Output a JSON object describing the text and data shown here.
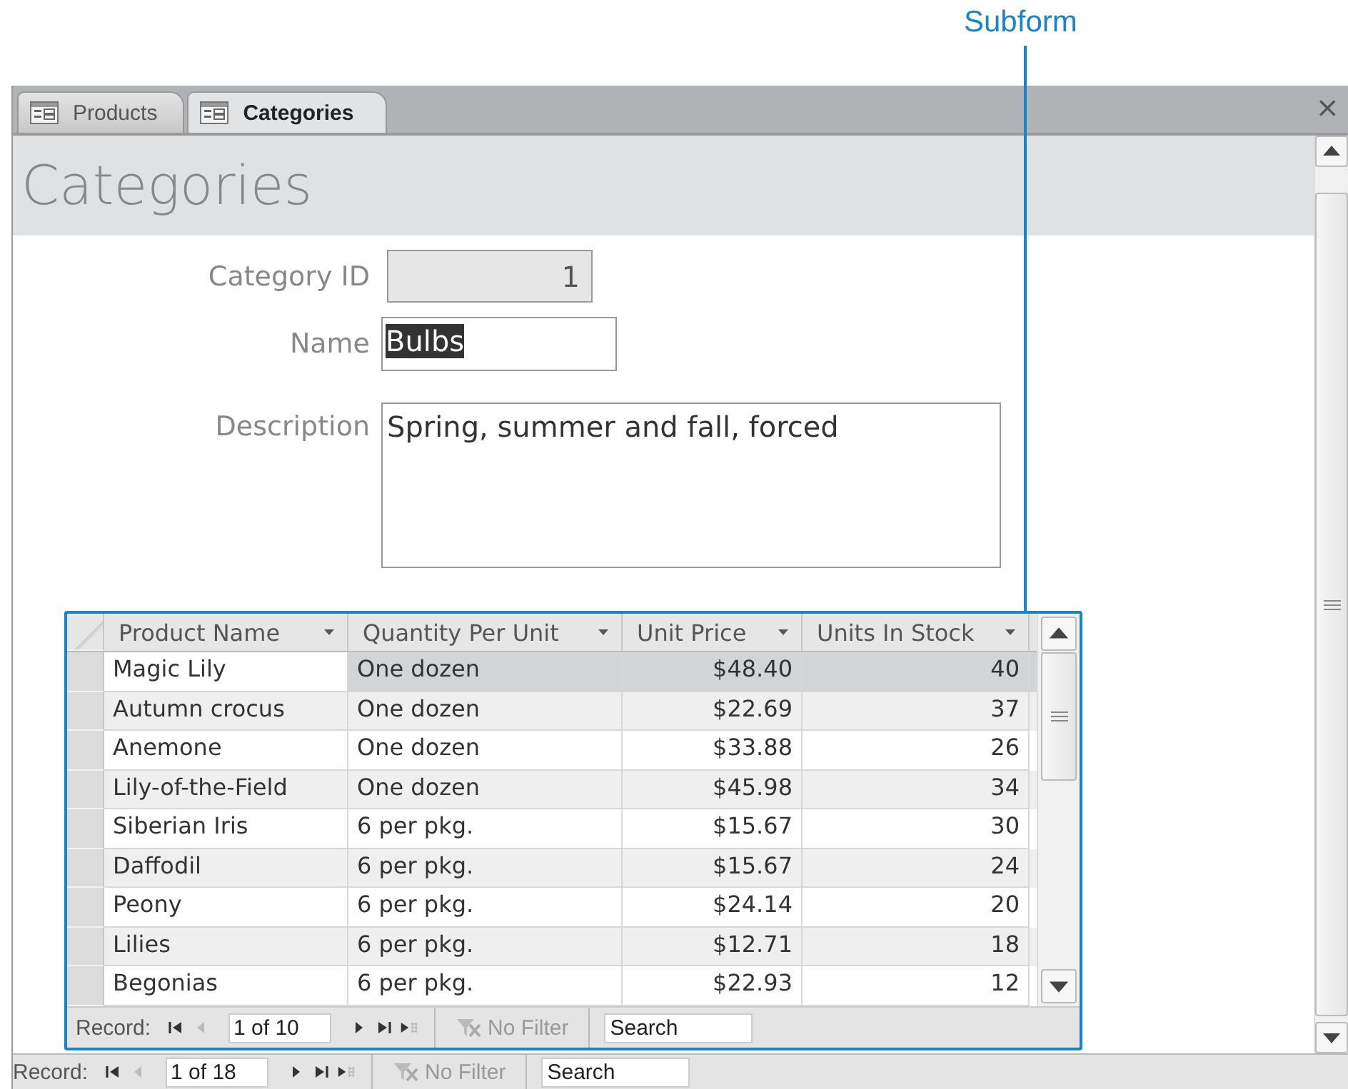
{
  "callout": {
    "label": "Subform"
  },
  "tabs": [
    {
      "label": "Products",
      "selected": false
    },
    {
      "label": "Categories",
      "selected": true
    }
  ],
  "close": "×",
  "form": {
    "title": "Categories",
    "fields": [
      {
        "label": "Category ID",
        "value": "1",
        "kind": "locked",
        "highlighted": false
      },
      {
        "label": "Name",
        "value": "Bulbs",
        "kind": "text",
        "highlighted": true
      },
      {
        "label": "Description",
        "value": "Spring, summer and fall, forced",
        "kind": "memo",
        "highlighted": false
      }
    ]
  },
  "subform": {
    "columns": [
      {
        "label": "Product Name",
        "kind": "text"
      },
      {
        "label": "Quantity Per Unit",
        "kind": "text"
      },
      {
        "label": "Unit Price",
        "kind": "number"
      },
      {
        "label": "Units In Stock",
        "kind": "number"
      }
    ],
    "rows": [
      {
        "cells": [
          "Magic Lily",
          "One dozen",
          "$48.40",
          "40"
        ],
        "selected": true
      },
      {
        "cells": [
          "Autumn crocus",
          "One dozen",
          "$22.69",
          "37"
        ],
        "selected": false
      },
      {
        "cells": [
          "Anemone",
          "One dozen",
          "$33.88",
          "26"
        ],
        "selected": false
      },
      {
        "cells": [
          "Lily-of-the-Field",
          "One dozen",
          "$45.98",
          "34"
        ],
        "selected": false
      },
      {
        "cells": [
          "Siberian Iris",
          "6 per pkg.",
          "$15.67",
          "30"
        ],
        "selected": false
      },
      {
        "cells": [
          "Daffodil",
          "6 per pkg.",
          "$15.67",
          "24"
        ],
        "selected": false
      },
      {
        "cells": [
          "Peony",
          "6 per pkg.",
          "$24.14",
          "20"
        ],
        "selected": false
      },
      {
        "cells": [
          "Lilies",
          "6 per pkg.",
          "$12.71",
          "18"
        ],
        "selected": false
      },
      {
        "cells": [
          "Begonias",
          "6 per pkg.",
          "$22.93",
          "12"
        ],
        "selected": false
      }
    ],
    "navigator": {
      "label": "Record:",
      "position": "1 of 10",
      "filter": "No Filter",
      "placeholder": "Search"
    }
  },
  "navigator": {
    "label": "Record:",
    "position": "1 of 18",
    "filter": "No Filter",
    "placeholder": "Search"
  }
}
